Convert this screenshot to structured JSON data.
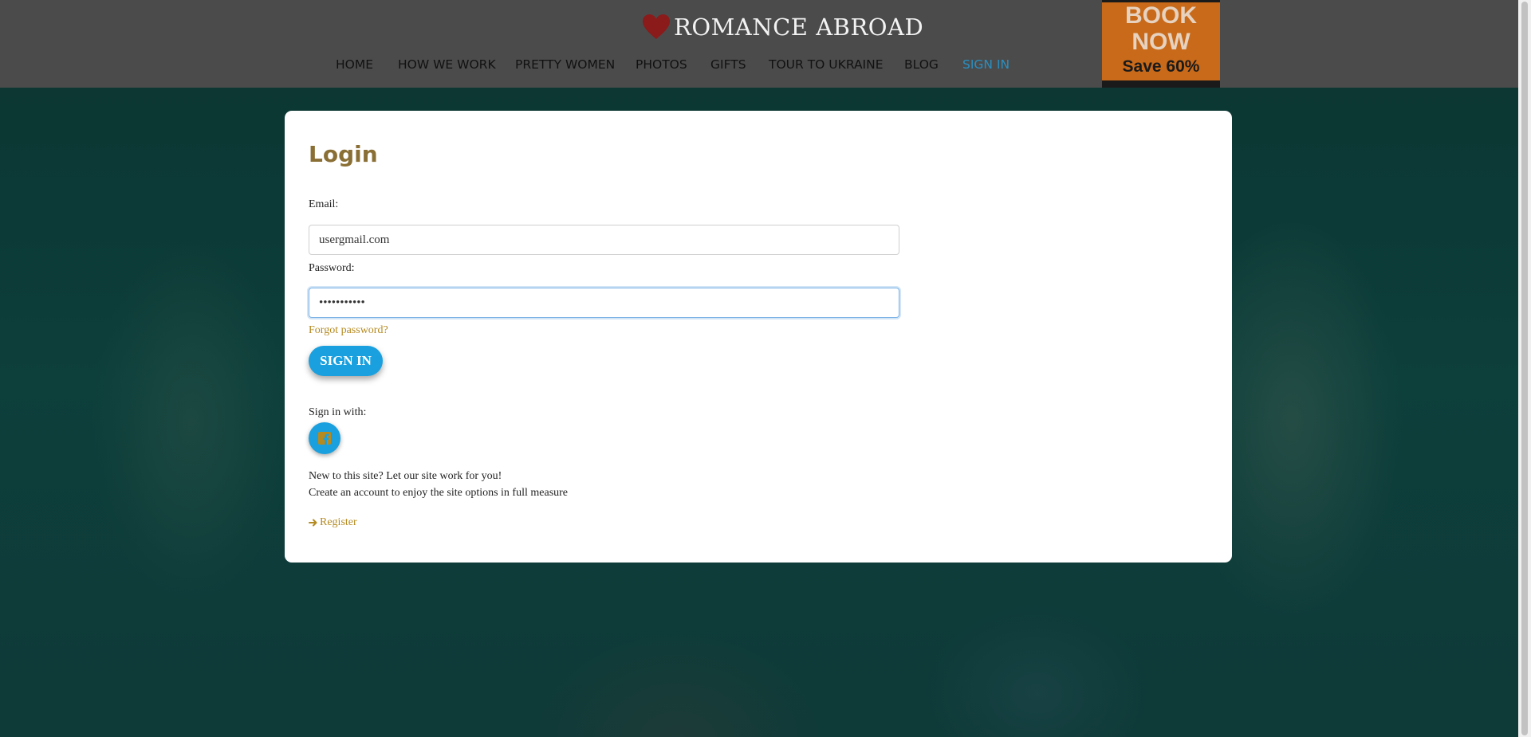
{
  "brand": {
    "name": "ROMANCE ABROAD",
    "logo_icon": "heart-icon",
    "heart_color": "#8b1a1a"
  },
  "nav": {
    "items": [
      {
        "label": "HOME"
      },
      {
        "label": "HOW WE WORK"
      },
      {
        "label": "PRETTY WOMEN"
      },
      {
        "label": "PHOTOS"
      },
      {
        "label": "GIFTS"
      },
      {
        "label": "TOUR TO UKRAINE"
      },
      {
        "label": "BLOG"
      },
      {
        "label": "SIGN IN",
        "active": true
      }
    ]
  },
  "promo": {
    "line1": "BOOK",
    "line2": "NOW",
    "line3": "Save 60%"
  },
  "login": {
    "title": "Login",
    "email_label": "Email:",
    "email_value": "usergmail.com",
    "password_label": "Password:",
    "password_value": "•••••••••••",
    "forgot_link": "Forgot password?",
    "signin_button": "SIGN IN",
    "signin_with_label": "Sign in with:",
    "social_icon": "facebook-icon",
    "new_line1": "New to this site? Let our site work for you!",
    "new_line2": "Create an account to enjoy the site options in full measure",
    "register_link": "Register",
    "register_icon": "arrow-right-icon"
  },
  "colors": {
    "accent_blue": "#1aa0de",
    "title_gold": "#8a6f35",
    "link_gold": "#b48a21",
    "nav_active": "#2a8fc1",
    "promo_orange": "#c86a1a"
  }
}
